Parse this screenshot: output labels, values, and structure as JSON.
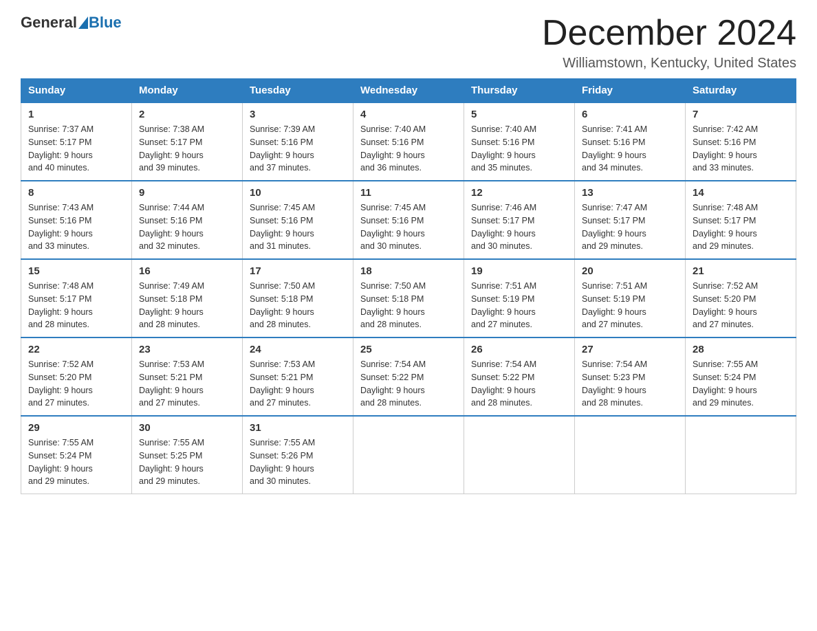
{
  "header": {
    "logo_general": "General",
    "logo_blue": "Blue",
    "month_title": "December 2024",
    "location": "Williamstown, Kentucky, United States"
  },
  "weekdays": [
    "Sunday",
    "Monday",
    "Tuesday",
    "Wednesday",
    "Thursday",
    "Friday",
    "Saturday"
  ],
  "weeks": [
    [
      {
        "day": "1",
        "sunrise": "7:37 AM",
        "sunset": "5:17 PM",
        "daylight": "9 hours and 40 minutes."
      },
      {
        "day": "2",
        "sunrise": "7:38 AM",
        "sunset": "5:17 PM",
        "daylight": "9 hours and 39 minutes."
      },
      {
        "day": "3",
        "sunrise": "7:39 AM",
        "sunset": "5:16 PM",
        "daylight": "9 hours and 37 minutes."
      },
      {
        "day": "4",
        "sunrise": "7:40 AM",
        "sunset": "5:16 PM",
        "daylight": "9 hours and 36 minutes."
      },
      {
        "day": "5",
        "sunrise": "7:40 AM",
        "sunset": "5:16 PM",
        "daylight": "9 hours and 35 minutes."
      },
      {
        "day": "6",
        "sunrise": "7:41 AM",
        "sunset": "5:16 PM",
        "daylight": "9 hours and 34 minutes."
      },
      {
        "day": "7",
        "sunrise": "7:42 AM",
        "sunset": "5:16 PM",
        "daylight": "9 hours and 33 minutes."
      }
    ],
    [
      {
        "day": "8",
        "sunrise": "7:43 AM",
        "sunset": "5:16 PM",
        "daylight": "9 hours and 33 minutes."
      },
      {
        "day": "9",
        "sunrise": "7:44 AM",
        "sunset": "5:16 PM",
        "daylight": "9 hours and 32 minutes."
      },
      {
        "day": "10",
        "sunrise": "7:45 AM",
        "sunset": "5:16 PM",
        "daylight": "9 hours and 31 minutes."
      },
      {
        "day": "11",
        "sunrise": "7:45 AM",
        "sunset": "5:16 PM",
        "daylight": "9 hours and 30 minutes."
      },
      {
        "day": "12",
        "sunrise": "7:46 AM",
        "sunset": "5:17 PM",
        "daylight": "9 hours and 30 minutes."
      },
      {
        "day": "13",
        "sunrise": "7:47 AM",
        "sunset": "5:17 PM",
        "daylight": "9 hours and 29 minutes."
      },
      {
        "day": "14",
        "sunrise": "7:48 AM",
        "sunset": "5:17 PM",
        "daylight": "9 hours and 29 minutes."
      }
    ],
    [
      {
        "day": "15",
        "sunrise": "7:48 AM",
        "sunset": "5:17 PM",
        "daylight": "9 hours and 28 minutes."
      },
      {
        "day": "16",
        "sunrise": "7:49 AM",
        "sunset": "5:18 PM",
        "daylight": "9 hours and 28 minutes."
      },
      {
        "day": "17",
        "sunrise": "7:50 AM",
        "sunset": "5:18 PM",
        "daylight": "9 hours and 28 minutes."
      },
      {
        "day": "18",
        "sunrise": "7:50 AM",
        "sunset": "5:18 PM",
        "daylight": "9 hours and 28 minutes."
      },
      {
        "day": "19",
        "sunrise": "7:51 AM",
        "sunset": "5:19 PM",
        "daylight": "9 hours and 27 minutes."
      },
      {
        "day": "20",
        "sunrise": "7:51 AM",
        "sunset": "5:19 PM",
        "daylight": "9 hours and 27 minutes."
      },
      {
        "day": "21",
        "sunrise": "7:52 AM",
        "sunset": "5:20 PM",
        "daylight": "9 hours and 27 minutes."
      }
    ],
    [
      {
        "day": "22",
        "sunrise": "7:52 AM",
        "sunset": "5:20 PM",
        "daylight": "9 hours and 27 minutes."
      },
      {
        "day": "23",
        "sunrise": "7:53 AM",
        "sunset": "5:21 PM",
        "daylight": "9 hours and 27 minutes."
      },
      {
        "day": "24",
        "sunrise": "7:53 AM",
        "sunset": "5:21 PM",
        "daylight": "9 hours and 27 minutes."
      },
      {
        "day": "25",
        "sunrise": "7:54 AM",
        "sunset": "5:22 PM",
        "daylight": "9 hours and 28 minutes."
      },
      {
        "day": "26",
        "sunrise": "7:54 AM",
        "sunset": "5:22 PM",
        "daylight": "9 hours and 28 minutes."
      },
      {
        "day": "27",
        "sunrise": "7:54 AM",
        "sunset": "5:23 PM",
        "daylight": "9 hours and 28 minutes."
      },
      {
        "day": "28",
        "sunrise": "7:55 AM",
        "sunset": "5:24 PM",
        "daylight": "9 hours and 29 minutes."
      }
    ],
    [
      {
        "day": "29",
        "sunrise": "7:55 AM",
        "sunset": "5:24 PM",
        "daylight": "9 hours and 29 minutes."
      },
      {
        "day": "30",
        "sunrise": "7:55 AM",
        "sunset": "5:25 PM",
        "daylight": "9 hours and 29 minutes."
      },
      {
        "day": "31",
        "sunrise": "7:55 AM",
        "sunset": "5:26 PM",
        "daylight": "9 hours and 30 minutes."
      },
      null,
      null,
      null,
      null
    ]
  ],
  "labels": {
    "sunrise_prefix": "Sunrise: ",
    "sunset_prefix": "Sunset: ",
    "daylight_prefix": "Daylight: "
  }
}
